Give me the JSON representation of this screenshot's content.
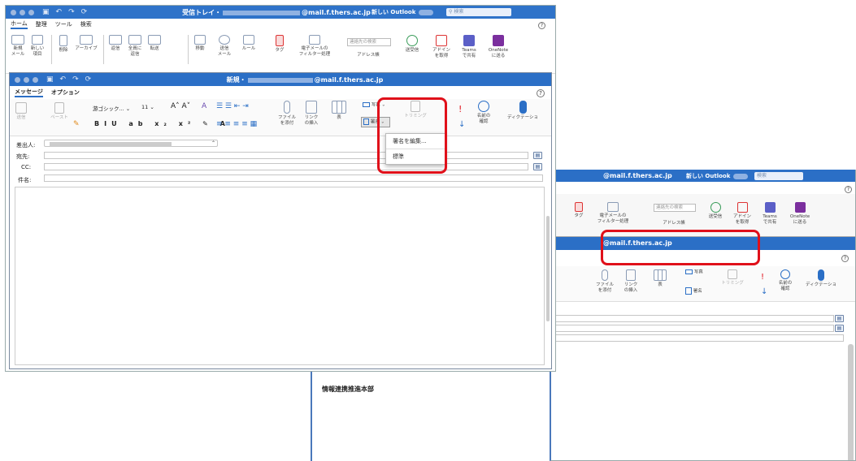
{
  "back_window": {
    "title_suffix": "@mail.f.thers.ac.jp",
    "inbox_label": "受信トレイ・",
    "new_outlook": "新しい Outlook",
    "search_placeholder": "検索",
    "tabs": [
      "ホーム",
      "整理",
      "ツール",
      "検索"
    ],
    "ribbon": {
      "new_mail": "新規\nメール",
      "new_item": "新しい\n項目",
      "delete": "削除",
      "archive": "アーカイブ",
      "reply": "返信",
      "reply_all": "全員に\n返信",
      "forward": "転送",
      "move": "移動",
      "rules_email": "送信\nメール",
      "rules": "ルール",
      "tag": "タグ",
      "filter": "電子メールの\nフィルター処理",
      "address_book": "アドレス帳",
      "contact_search": "連絡先の検索",
      "send_receive": "送受信",
      "addin": "アドイン\nを取得",
      "teams": "Teams\nで共有",
      "onenote": "OneNote\nに送る"
    }
  },
  "compose": {
    "title_prefix": "新規・",
    "title_suffix": "@mail.f.thers.ac.jp",
    "tabs": [
      "メッセージ",
      "オプション"
    ],
    "font_name": "游ゴシック...",
    "font_size": "11",
    "ribbon": {
      "paste": "ペースト",
      "send": "送信",
      "attach": "ファイル\nを添付",
      "link": "リンク\nの挿入",
      "table": "表",
      "picture": "写真",
      "signature": "署名",
      "trim": "トリミング",
      "names": "名前の\n確認",
      "dictate": "ディクテーショ"
    },
    "signature_menu": [
      "署名を編集...",
      "標準"
    ],
    "from_label": "差出人:",
    "to_label": "宛先:",
    "cc_label": "CC:",
    "subject_label": "件名:"
  },
  "right_window": {
    "title_suffix": "@mail.f.thers.ac.jp",
    "compose_title": "@mail.f.thers.ac.jp",
    "new_outlook": "新しい Outlook",
    "search_placeholder": "検索",
    "ribbon": {
      "tag": "タグ",
      "filter": "電子メールの\nフィルター処理",
      "contact_search": "連絡先の検索",
      "address_book": "アドレス帳",
      "send_receive": "送受信",
      "addin": "アドイン\nを取得",
      "teams": "Teams\nで共有",
      "onenote": "OneNote\nに送る",
      "attach": "ファイル\nを添付",
      "link": "リンク\nの挿入",
      "table": "表",
      "picture": "写真",
      "signature": "署名",
      "trim": "トリミング",
      "names": "名前の\n確認",
      "dictate": "ディクテーショ"
    },
    "signature_text": "情報連携推進本部"
  },
  "colors": {
    "titlebar": "#2b6fc6",
    "highlight": "#e0101a"
  }
}
